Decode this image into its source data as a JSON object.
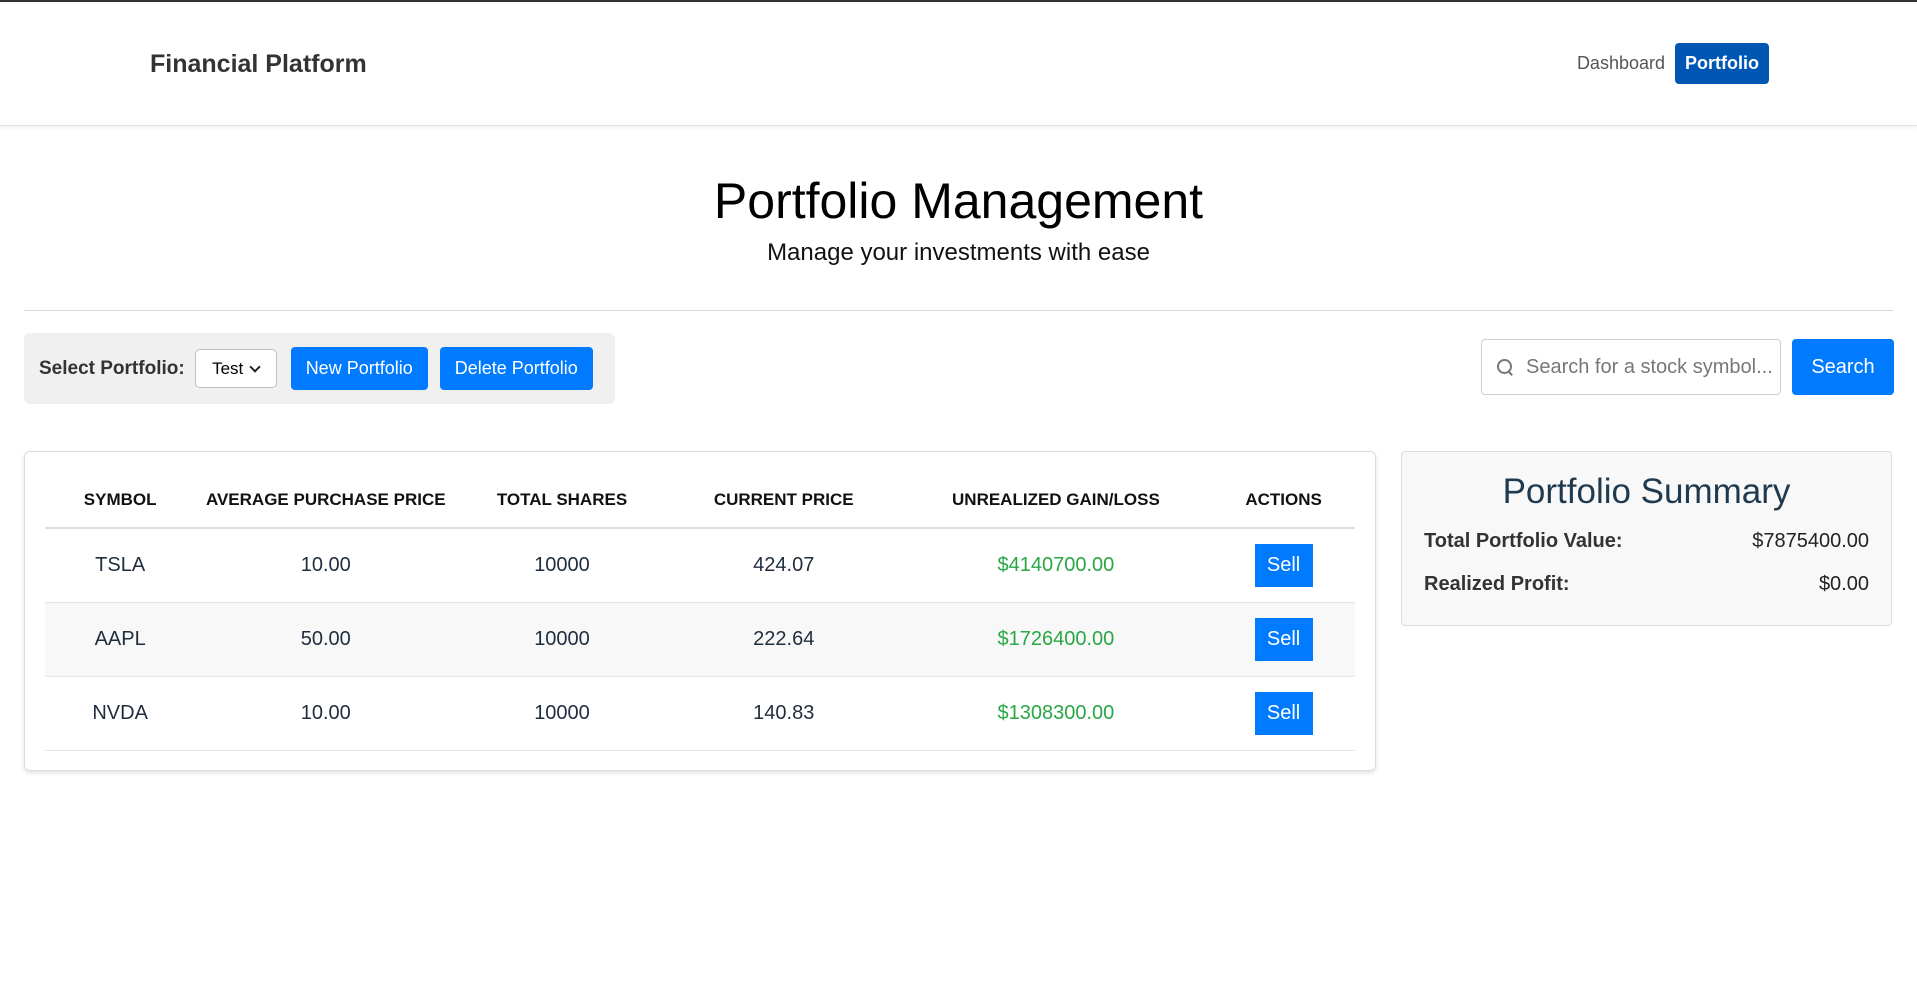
{
  "header": {
    "brand": "Financial Platform",
    "nav": {
      "dashboard": "Dashboard",
      "portfolio": "Portfolio"
    }
  },
  "hero": {
    "title": "Portfolio Management",
    "subtitle": "Manage your investments with ease"
  },
  "controls": {
    "select_label": "Select Portfolio:",
    "selected_portfolio": "Test",
    "new_portfolio": "New Portfolio",
    "delete_portfolio": "Delete Portfolio"
  },
  "search": {
    "placeholder": "Search for a stock symbol...",
    "button": "Search"
  },
  "table": {
    "columns": [
      "SYMBOL",
      "AVERAGE PURCHASE PRICE",
      "TOTAL SHARES",
      "CURRENT PRICE",
      "UNREALIZED GAIN/LOSS",
      "ACTIONS"
    ],
    "rows": [
      {
        "symbol": "TSLA",
        "avg_price": "10.00",
        "shares": "10000",
        "current": "424.07",
        "gain": "$4140700.00",
        "action": "Sell"
      },
      {
        "symbol": "AAPL",
        "avg_price": "50.00",
        "shares": "10000",
        "current": "222.64",
        "gain": "$1726400.00",
        "action": "Sell"
      },
      {
        "symbol": "NVDA",
        "avg_price": "10.00",
        "shares": "10000",
        "current": "140.83",
        "gain": "$1308300.00",
        "action": "Sell"
      }
    ]
  },
  "summary": {
    "title": "Portfolio Summary",
    "total_label": "Total Portfolio Value:",
    "total_value": "$7875400.00",
    "profit_label": "Realized Profit:",
    "profit_value": "$0.00"
  },
  "colors": {
    "primary": "#007bff",
    "nav_active": "#0056b3",
    "gain": "#28a745"
  }
}
